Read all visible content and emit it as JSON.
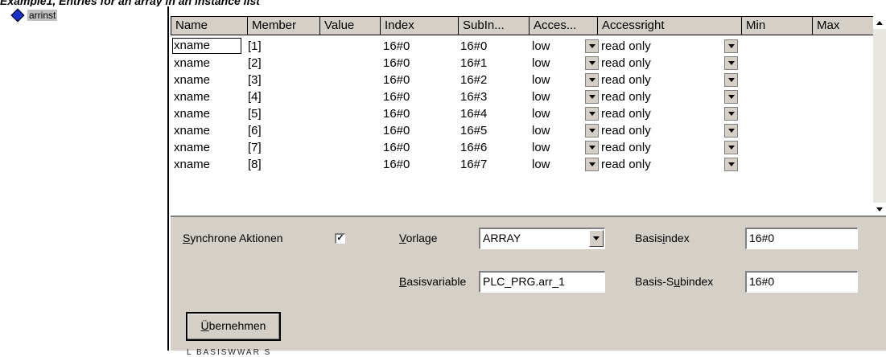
{
  "caption": "Example1, Entries for an array in an instance list",
  "tree": {
    "item_label": "arrinst"
  },
  "grid": {
    "headers": [
      "Name",
      "Member",
      "Value",
      "Index",
      "SubIn...",
      "Acces...",
      "Accessright",
      "Min",
      "Max"
    ],
    "rows": [
      {
        "name": "xname",
        "member": "[1]",
        "value": "",
        "index": "16#0",
        "subindex": "16#0",
        "access": "low",
        "accessright": "read only",
        "min": "",
        "max": ""
      },
      {
        "name": "xname",
        "member": "[2]",
        "value": "",
        "index": "16#0",
        "subindex": "16#1",
        "access": "low",
        "accessright": "read only",
        "min": "",
        "max": ""
      },
      {
        "name": "xname",
        "member": "[3]",
        "value": "",
        "index": "16#0",
        "subindex": "16#2",
        "access": "low",
        "accessright": "read only",
        "min": "",
        "max": ""
      },
      {
        "name": "xname",
        "member": "[4]",
        "value": "",
        "index": "16#0",
        "subindex": "16#3",
        "access": "low",
        "accessright": "read only",
        "min": "",
        "max": ""
      },
      {
        "name": "xname",
        "member": "[5]",
        "value": "",
        "index": "16#0",
        "subindex": "16#4",
        "access": "low",
        "accessright": "read only",
        "min": "",
        "max": ""
      },
      {
        "name": "xname",
        "member": "[6]",
        "value": "",
        "index": "16#0",
        "subindex": "16#5",
        "access": "low",
        "accessright": "read only",
        "min": "",
        "max": ""
      },
      {
        "name": "xname",
        "member": "[7]",
        "value": "",
        "index": "16#0",
        "subindex": "16#6",
        "access": "low",
        "accessright": "read only",
        "min": "",
        "max": ""
      },
      {
        "name": "xname",
        "member": "[8]",
        "value": "",
        "index": "16#0",
        "subindex": "16#7",
        "access": "low",
        "accessright": "read only",
        "min": "",
        "max": ""
      }
    ]
  },
  "panel": {
    "sync_label_u": "S",
    "sync_label_rest": "ynchrone Aktionen",
    "sync_checked": true,
    "sync_check_glyph": "✓",
    "vorlage_u": "V",
    "vorlage_rest": "orlage",
    "vorlage_value": "ARRAY",
    "basisindex_pre": "Basis",
    "basisindex_u": "i",
    "basisindex_rest": "ndex",
    "basisindex_value": "16#0",
    "basisvariable_u": "B",
    "basisvariable_rest": "asisvariable",
    "basisvariable_value": "PLC_PRG.arr_1",
    "basissub_pre": "Basis-S",
    "basissub_u": "u",
    "basissub_rest": "bindex",
    "basissub_value": "16#0",
    "apply_u": "Ü",
    "apply_rest": "bernehmen",
    "cutoff_text": "L  BASISWWAR  S"
  }
}
